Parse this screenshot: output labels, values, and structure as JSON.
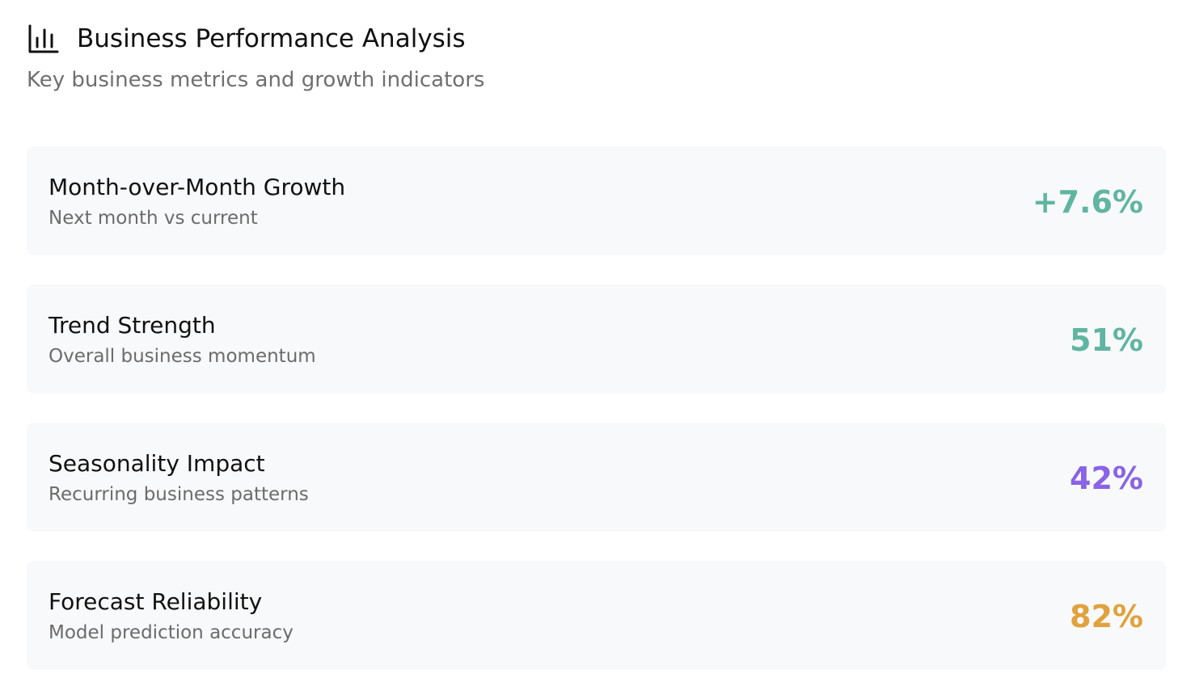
{
  "header": {
    "icon": "bar-chart-icon",
    "title": "Business Performance Analysis",
    "subtitle": "Key business metrics and growth indicators"
  },
  "metrics": [
    {
      "title": "Month-over-Month Growth",
      "description": "Next month vs current",
      "value": "+7.6%",
      "color": "#5fb5a2"
    },
    {
      "title": "Trend Strength",
      "description": "Overall business momentum",
      "value": "51%",
      "color": "#5fb5a2"
    },
    {
      "title": "Seasonality Impact",
      "description": "Recurring business patterns",
      "value": "42%",
      "color": "#8a63e6"
    },
    {
      "title": "Forecast Reliability",
      "description": "Model prediction accuracy",
      "value": "82%",
      "color": "#e0a23d"
    }
  ]
}
